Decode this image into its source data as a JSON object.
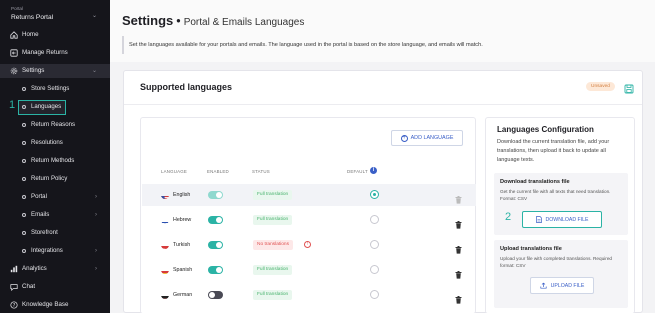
{
  "sidebar": {
    "portal_caption": "Portal",
    "portal_name": "Returns Portal",
    "items": {
      "home": "Home",
      "manage_returns": "Manage Returns",
      "settings": "Settings",
      "store_settings": "Store Settings",
      "languages": "Languages",
      "return_reasons": "Return Reasons",
      "resolutions": "Resolutions",
      "return_methods": "Return Methods",
      "return_policy": "Return Policy",
      "portal": "Portal",
      "emails": "Emails",
      "storefront": "Storefront",
      "integrations": "Integrations",
      "analytics": "Analytics",
      "chat": "Chat",
      "knowledge_base": "Knowledge Base"
    }
  },
  "header": {
    "title": "Settings",
    "separator": "•",
    "subtitle": "Portal & Emails Languages",
    "description": "Set the languages available for your portals and emails. The language used in the portal is based on the store language, and emails will match."
  },
  "card": {
    "title": "Supported languages",
    "unsaved_badge": "Unsaved"
  },
  "table": {
    "add_button": "ADD LANGUAGE",
    "headers": {
      "language": "LANGUAGE",
      "enabled": "ENABLED",
      "status": "STATUS",
      "default": "DEFAULT"
    },
    "rows": [
      {
        "language": "English",
        "enabled": true,
        "status": "Full translation",
        "status_type": "full",
        "default": true
      },
      {
        "language": "Hebrew",
        "enabled": true,
        "status": "Full translation",
        "status_type": "full",
        "default": false
      },
      {
        "language": "Turkish",
        "enabled": true,
        "status": "No translations",
        "status_type": "none",
        "default": false
      },
      {
        "language": "Spanish",
        "enabled": true,
        "status": "Full translation",
        "status_type": "full",
        "default": false
      },
      {
        "language": "German",
        "enabled": false,
        "status": "Full translation",
        "status_type": "full",
        "default": false
      }
    ]
  },
  "config": {
    "title": "Languages Configuration",
    "description": "Download the current translation file, add your translations, then upload it back to update all language texts.",
    "download": {
      "title": "Download translations file",
      "description": "Get the current file with all texts that need translation. Format: CSV",
      "button": "DOWNLOAD FILE"
    },
    "upload": {
      "title": "Upload translations file",
      "description": "Upload your file with completed translations. Required format: CSV",
      "button": "UPLOAD FILE"
    }
  },
  "annotations": {
    "step1": "1",
    "step2": "2"
  },
  "colors": {
    "sidebar_bg": "#15151b",
    "accent_teal": "#2bb3a5",
    "link_blue": "#3a5fc7",
    "success_green": "#48b36d",
    "error_red": "#e05252",
    "warning_orange": "#d38143"
  }
}
